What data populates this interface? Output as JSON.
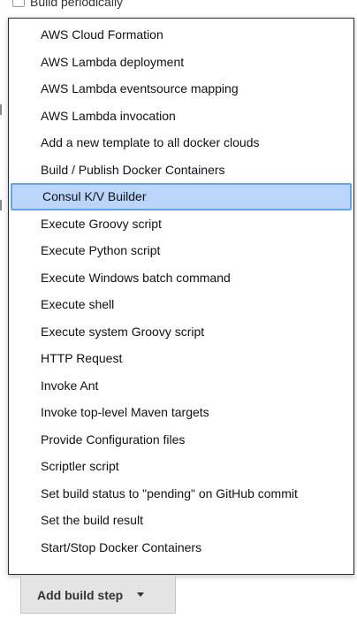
{
  "background": {
    "partial_text": "Build periodically"
  },
  "menu": {
    "selected_index": 6,
    "items": [
      "AWS Cloud Formation",
      "AWS Lambda deployment",
      "AWS Lambda eventsource mapping",
      "AWS Lambda invocation",
      "Add a new template to all docker clouds",
      "Build / Publish Docker Containers",
      "Consul K/V Builder",
      "Execute Groovy script",
      "Execute Python script",
      "Execute Windows batch command",
      "Execute shell",
      "Execute system Groovy script",
      "HTTP Request",
      "Invoke Ant",
      "Invoke top-level Maven targets",
      "Provide Configuration files",
      "Scriptler script",
      "Set build status to \"pending\" on GitHub commit",
      "Set the build result",
      "Start/Stop Docker Containers"
    ]
  },
  "button": {
    "label": "Add build step",
    "caret_icon": "caret-down-icon"
  }
}
